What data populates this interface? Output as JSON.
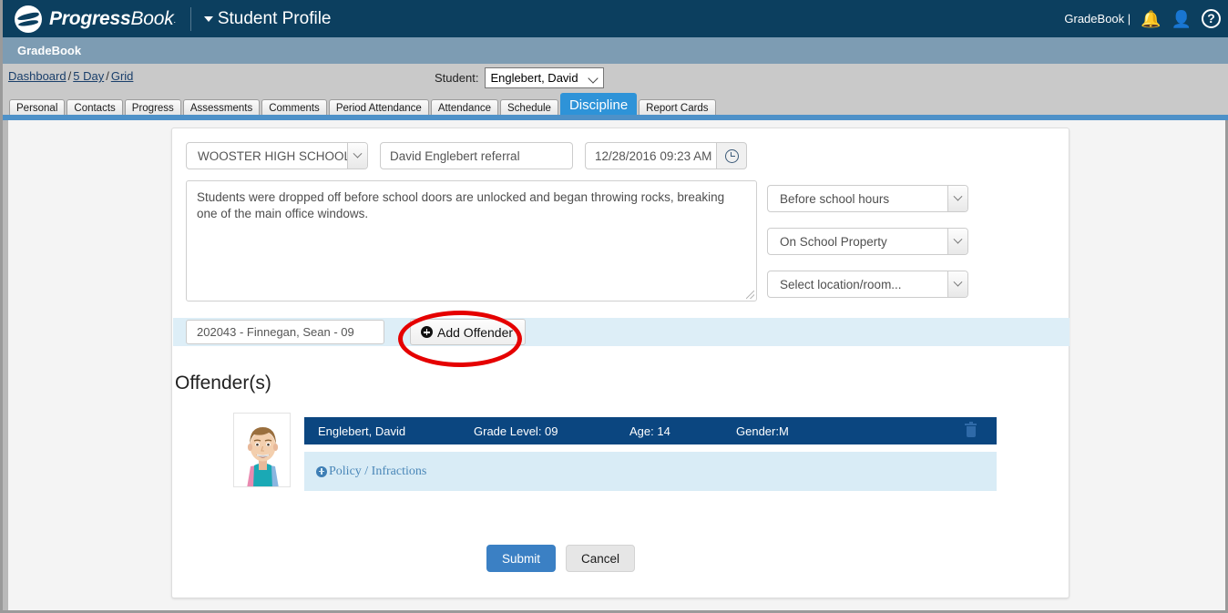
{
  "topbar": {
    "brand_bold": "Progress",
    "brand_thin": "Book",
    "brand_tm": ".",
    "page_title": "Student Profile",
    "right_label": "GradeBook |",
    "bell_icon": "bell-icon",
    "user_icon": "user-icon",
    "help_icon": "help-icon",
    "bg_color": "#0c3f5f"
  },
  "subbar": {
    "label": "GradeBook",
    "bg_color": "#7d9cb3"
  },
  "breadcrumb": {
    "items": [
      "Dashboard",
      "5 Day",
      "Grid"
    ],
    "separator": "/"
  },
  "student_picker": {
    "label": "Student:",
    "value": "Englebert, David"
  },
  "tabs": [
    {
      "label": "Personal",
      "active": false
    },
    {
      "label": "Contacts",
      "active": false
    },
    {
      "label": "Progress",
      "active": false
    },
    {
      "label": "Assessments",
      "active": false
    },
    {
      "label": "Comments",
      "active": false
    },
    {
      "label": "Period Attendance",
      "active": false
    },
    {
      "label": "Attendance",
      "active": false
    },
    {
      "label": "Schedule",
      "active": false
    },
    {
      "label": "Discipline",
      "active": true
    },
    {
      "label": "Report Cards",
      "active": false
    }
  ],
  "form": {
    "school": "WOOSTER HIGH SCHOOL",
    "referral_title": "David Englebert referral",
    "incident_datetime": "12/28/2016 09:23 AM",
    "clock_icon": "clock-icon",
    "description": "Students were dropped off before school doors are unlocked and began throwing rocks, breaking one of the main office windows.",
    "time_frame": "Before school hours",
    "location_type": "On School Property",
    "location_room": "Select location/room..."
  },
  "offender_search": {
    "value": "202043 -  Finnegan, Sean - 09",
    "add_button_label": "Add Offender",
    "add_icon": "plus-circle-icon",
    "highlight_color": "#e50000"
  },
  "offenders_section": {
    "heading": "Offender(s)",
    "rows": [
      {
        "name": "Englebert, David",
        "grade": "Grade Level: 09",
        "age": "Age: 14",
        "gender": "Gender:M",
        "delete_icon": "trash-icon",
        "policy_link": "Policy / Infractions",
        "policy_icon": "plus-circle-icon",
        "photo": "student-photo",
        "row_color": "#0b4680",
        "policy_band_color": "#d9ecf6"
      }
    ]
  },
  "footer": {
    "submit_label": "Submit",
    "cancel_label": "Cancel",
    "submit_color": "#3b80c4"
  }
}
